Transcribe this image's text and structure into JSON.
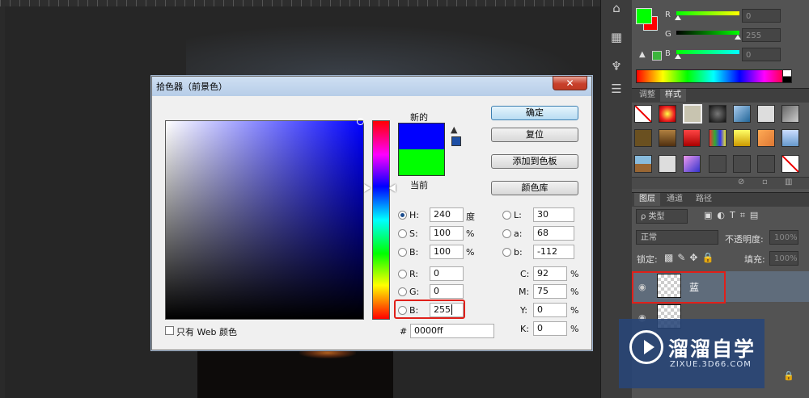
{
  "dialog": {
    "title": "拾色器（前景色）",
    "close_label": "✕",
    "new_label": "新的",
    "current_label": "当前",
    "new_color": "#0000ff",
    "current_color": "#00ff00",
    "buttons": {
      "ok": "确定",
      "reset": "复位",
      "add_swatch": "添加到色板",
      "libraries": "颜色库"
    },
    "fields": {
      "H": {
        "label": "H:",
        "value": "240",
        "unit": "度"
      },
      "S": {
        "label": "S:",
        "value": "100",
        "unit": "%"
      },
      "Bri": {
        "label": "B:",
        "value": "100",
        "unit": "%"
      },
      "R": {
        "label": "R:",
        "value": "0"
      },
      "G": {
        "label": "G:",
        "value": "0"
      },
      "Blue": {
        "label": "B:",
        "value": "255"
      },
      "L": {
        "label": "L:",
        "value": "30"
      },
      "a": {
        "label": "a:",
        "value": "68"
      },
      "b": {
        "label": "b:",
        "value": "-112"
      },
      "C": {
        "label": "C:",
        "value": "92",
        "unit": "%"
      },
      "M": {
        "label": "M:",
        "value": "75",
        "unit": "%"
      },
      "Y": {
        "label": "Y:",
        "value": "0",
        "unit": "%"
      },
      "K": {
        "label": "K:",
        "value": "0",
        "unit": "%"
      },
      "hex": {
        "label": "#",
        "value": "0000ff"
      }
    },
    "web_only_label": "只有 Web 颜色",
    "selected_mode": "H"
  },
  "color_panel": {
    "labels": {
      "r": "R",
      "g": "G",
      "b": "B"
    },
    "values": {
      "r": "0",
      "g": "255",
      "b": "0"
    },
    "foreground": "#00ff00",
    "background": "#ff0000"
  },
  "styles_panel": {
    "tabs": [
      "调整",
      "样式"
    ]
  },
  "layers_panel": {
    "tabs": [
      "图层",
      "通道",
      "路径"
    ],
    "filter": "ρ 类型",
    "blend_mode": "正常",
    "opacity_label": "不透明度:",
    "opacity_value": "100%",
    "lock_label": "锁定:",
    "fill_label": "填充:",
    "fill_value": "100%",
    "layers": [
      "蓝"
    ]
  },
  "watermark": {
    "title": "溜溜自学",
    "url": "ZIXUE.3D66.COM"
  },
  "icons": {
    "close": "close-icon",
    "warning": "warning-triangle-icon",
    "eye": "eye-icon",
    "lock": "lock-icon",
    "play": "play-icon"
  }
}
